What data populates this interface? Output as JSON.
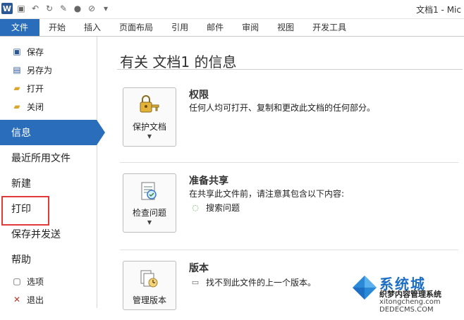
{
  "window": {
    "doc_title": "文档1 - Mic"
  },
  "ribbon": {
    "tabs": [
      "文件",
      "开始",
      "插入",
      "页面布局",
      "引用",
      "邮件",
      "审阅",
      "视图",
      "开发工具"
    ]
  },
  "sidebar": {
    "commands": [
      {
        "label": "保存",
        "icon": "save-icon"
      },
      {
        "label": "另存为",
        "icon": "save-as-icon"
      },
      {
        "label": "打开",
        "icon": "open-folder-icon"
      },
      {
        "label": "关闭",
        "icon": "close-folder-icon"
      }
    ],
    "nav": [
      "信息",
      "最近所用文件",
      "新建",
      "打印",
      "保存并发送",
      "帮助"
    ],
    "active_nav": "信息",
    "footer": [
      {
        "label": "选项",
        "icon": "options-icon"
      },
      {
        "label": "退出",
        "icon": "exit-icon"
      }
    ]
  },
  "main": {
    "title": "有关 文档1 的信息",
    "permissions": {
      "button": "保护文档",
      "title": "权限",
      "desc": "任何人均可打开、复制和更改此文档的任何部分。"
    },
    "share": {
      "button": "检查问题",
      "title": "准备共享",
      "desc": "在共享此文件前，请注意其包含以下内容:",
      "item": "搜索问题"
    },
    "versions": {
      "button": "管理版本",
      "title": "版本",
      "item": "找不到此文件的上一个版本。"
    }
  },
  "watermark": {
    "brand": "系统城",
    "line2": "织梦内容管理系统",
    "line3": "xitongcheng.com",
    "line4": "DEDECMS.COM"
  },
  "colors": {
    "accent": "#2a6ebb",
    "highlight": "#e03a3a"
  }
}
